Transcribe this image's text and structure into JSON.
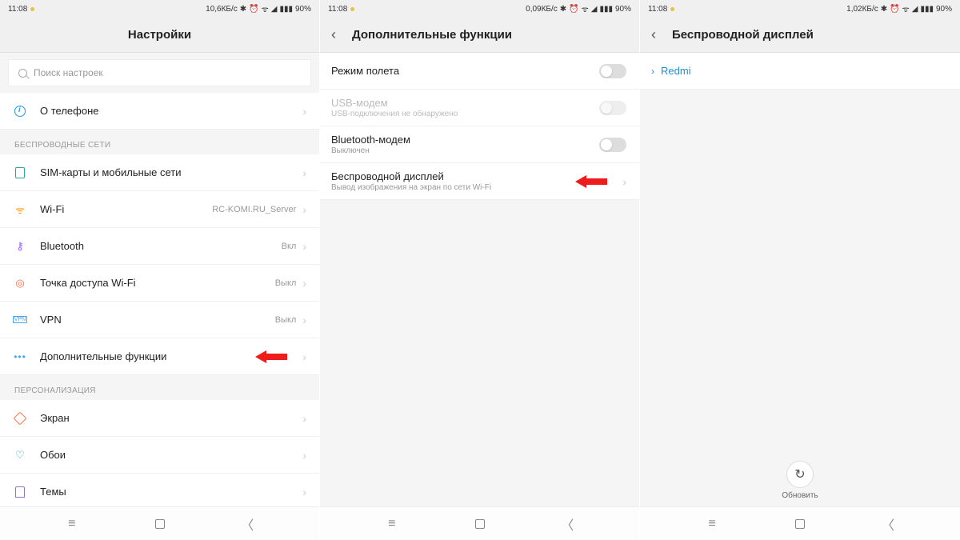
{
  "status": {
    "time": "11:08",
    "battery_pct": "90%",
    "net1": "10,6КБ/с",
    "net2": "0,09КБ/с",
    "net3": "1,02КБ/с"
  },
  "screen1": {
    "title": "Настройки",
    "search_placeholder": "Поиск настроек",
    "about_label": "О телефоне",
    "section_wireless": "БЕСПРОВОДНЫЕ СЕТИ",
    "items": {
      "sim": "SIM-карты и мобильные сети",
      "wifi": "Wi-Fi",
      "wifi_val": "RC-KOMI.RU_Server",
      "bt": "Bluetooth",
      "bt_val": "Вкл",
      "hotspot": "Точка доступа Wi-Fi",
      "hotspot_val": "Выкл",
      "vpn": "VPN",
      "vpn_val": "Выкл",
      "more": "Дополнительные функции"
    },
    "section_personal": "ПЕРСОНАЛИЗАЦИЯ",
    "personal": {
      "screen": "Экран",
      "wallpaper": "Обои",
      "themes": "Темы"
    }
  },
  "screen2": {
    "title": "Дополнительные функции",
    "items": {
      "airplane": "Режим полета",
      "usb": "USB-модем",
      "usb_sub": "USB-подключения не обнаружено",
      "btmodem": "Bluetooth-модем",
      "btmodem_sub": "Выключен",
      "cast": "Беспроводной дисплей",
      "cast_sub": "Вывод изображения на экран по сети Wi-Fi"
    }
  },
  "screen3": {
    "title": "Беспроводной дисплей",
    "device": "Redmi",
    "refresh": "Обновить"
  }
}
